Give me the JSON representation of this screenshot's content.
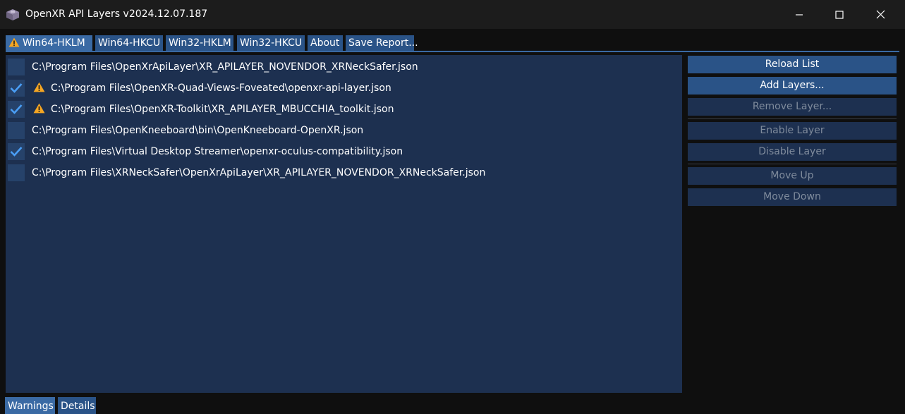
{
  "window": {
    "title": "OpenXR API Layers v2024.12.07.187"
  },
  "tabs": [
    {
      "label": "Win64-HKLM",
      "warning": true,
      "active": true
    },
    {
      "label": "Win64-HKCU"
    },
    {
      "label": "Win32-HKLM"
    },
    {
      "label": "Win32-HKCU"
    },
    {
      "label": "About"
    },
    {
      "label": "Save Report..."
    }
  ],
  "layers": [
    {
      "path": "C:\\Program Files\\OpenXrApiLayer\\XR_APILAYER_NOVENDOR_XRNeckSafer.json",
      "enabled": false,
      "warning": false
    },
    {
      "path": "C:\\Program Files\\OpenXR-Quad-Views-Foveated\\openxr-api-layer.json",
      "enabled": true,
      "warning": true
    },
    {
      "path": "C:\\Program Files\\OpenXR-Toolkit\\XR_APILAYER_MBUCCHIA_toolkit.json",
      "enabled": true,
      "warning": true
    },
    {
      "path": "C:\\Program Files\\OpenKneeboard\\bin\\OpenKneeboard-OpenXR.json",
      "enabled": false,
      "warning": false
    },
    {
      "path": "C:\\Program Files\\Virtual Desktop Streamer\\openxr-oculus-compatibility.json",
      "enabled": true,
      "warning": false
    },
    {
      "path": "C:\\Program Files\\XRNeckSafer\\OpenXrApiLayer\\XR_APILAYER_NOVENDOR_XRNeckSafer.json",
      "enabled": false,
      "warning": false
    }
  ],
  "actions": {
    "reload_list": "Reload List",
    "add_layers": "Add Layers...",
    "remove_layer": "Remove Layer...",
    "enable_layer": "Enable Layer",
    "disable_layer": "Disable Layer",
    "move_up": "Move Up",
    "move_down": "Move Down"
  },
  "bottom_tabs": [
    {
      "label": "Warnings",
      "active": true
    },
    {
      "label": "Details"
    }
  ],
  "colors": {
    "accent": "#2a5387",
    "accent_active": "#3a6aa4",
    "list_background": "#1d3050",
    "checkmark": "#4a9ef5",
    "warning": "#f5a623"
  }
}
